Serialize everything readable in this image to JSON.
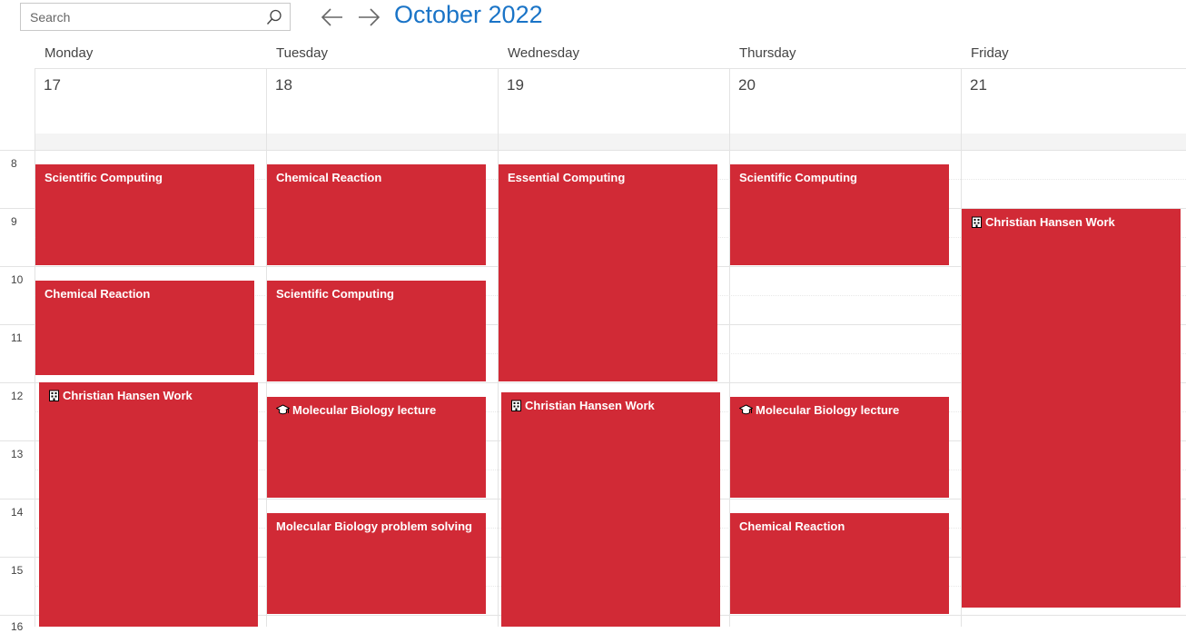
{
  "search": {
    "placeholder": "Search",
    "value": "",
    "icon": "search-icon"
  },
  "nav": {
    "prev_icon": "arrow-left-icon",
    "next_icon": "arrow-right-icon"
  },
  "title": "October 2022",
  "colors": {
    "accent": "#1a74c7",
    "event": "#d12a36"
  },
  "days": [
    {
      "name": "Monday",
      "date": "17"
    },
    {
      "name": "Tuesday",
      "date": "18"
    },
    {
      "name": "Wednesday",
      "date": "19"
    },
    {
      "name": "Thursday",
      "date": "20"
    },
    {
      "name": "Friday",
      "date": "21"
    }
  ],
  "hours": [
    "8",
    "9",
    "10",
    "11",
    "12",
    "13",
    "14",
    "15",
    "16"
  ],
  "events": [
    {
      "day": "Monday",
      "title": "Scientific Computing",
      "icon": ""
    },
    {
      "day": "Monday",
      "title": "Chemical Reaction",
      "icon": ""
    },
    {
      "day": "Monday",
      "title": "Christian Hansen Work",
      "icon": "building-icon"
    },
    {
      "day": "Tuesday",
      "title": "Chemical Reaction",
      "icon": ""
    },
    {
      "day": "Tuesday",
      "title": "Scientific Computing",
      "icon": ""
    },
    {
      "day": "Tuesday",
      "title": "Molecular Biology lecture",
      "icon": "graduation-cap-icon"
    },
    {
      "day": "Tuesday",
      "title": "Molecular Biology problem solving",
      "icon": ""
    },
    {
      "day": "Wednesday",
      "title": "Essential Computing",
      "icon": ""
    },
    {
      "day": "Wednesday",
      "title": "Christian Hansen Work",
      "icon": "building-icon"
    },
    {
      "day": "Thursday",
      "title": "Scientific Computing",
      "icon": ""
    },
    {
      "day": "Thursday",
      "title": "Molecular Biology lecture",
      "icon": "graduation-cap-icon"
    },
    {
      "day": "Thursday",
      "title": "Chemical Reaction",
      "icon": ""
    },
    {
      "day": "Friday",
      "title": "Christian Hansen Work",
      "icon": "building-icon"
    }
  ]
}
